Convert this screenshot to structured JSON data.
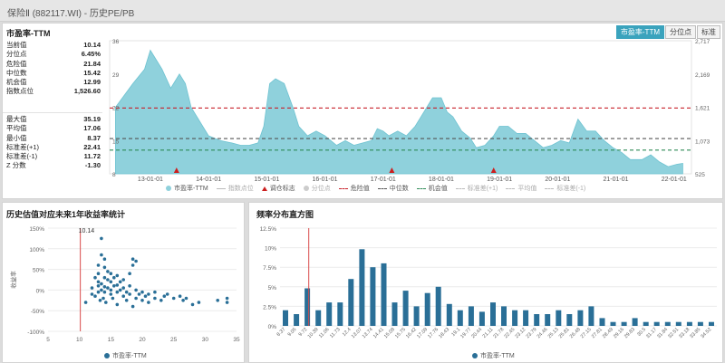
{
  "window": {
    "title": "保险Ⅱ (882117.WI) - 历史PE/PB"
  },
  "top_panel": {
    "title": "市盈率-TTM",
    "tabs": [
      "市盈率-TTM",
      "分位点",
      "标准"
    ],
    "stats_group1": [
      {
        "label": "当前值",
        "value": "10.14"
      },
      {
        "label": "分位点",
        "value": "6.45%"
      },
      {
        "label": "危险值",
        "value": "21.84"
      },
      {
        "label": "中位数",
        "value": "15.42"
      },
      {
        "label": "机会值",
        "value": "12.99"
      },
      {
        "label": "指数点位",
        "value": "1,526.60"
      }
    ],
    "stats_group2": [
      {
        "label": "最大值",
        "value": "35.19"
      },
      {
        "label": "平均值",
        "value": "17.06"
      },
      {
        "label": "最小值",
        "value": "8.37"
      },
      {
        "label": "标准差(+1)",
        "value": "22.41"
      },
      {
        "label": "标准差(-1)",
        "value": "11.72"
      },
      {
        "label": "Z 分数",
        "value": "-1.30"
      }
    ],
    "legend": [
      {
        "label": "市盈率-TTM",
        "kind": "dot",
        "color": "#8fd1dc",
        "dim": false
      },
      {
        "label": "指数点位",
        "kind": "line",
        "color": "#bbbbbb",
        "dim": true
      },
      {
        "label": "调仓标志",
        "kind": "tri",
        "color": "#cc1f1f",
        "dim": false
      },
      {
        "label": "分位点",
        "kind": "dot",
        "color": "#cccccc",
        "dim": true
      },
      {
        "label": "危险值",
        "kind": "dash",
        "color": "#c8202a",
        "dim": false
      },
      {
        "label": "中位数",
        "kind": "dash",
        "color": "#555555",
        "dim": false
      },
      {
        "label": "机会值",
        "kind": "dash",
        "color": "#2e8b57",
        "dim": false
      },
      {
        "label": "标准差(+1)",
        "kind": "dash",
        "color": "#bbbbbb",
        "dim": true
      },
      {
        "label": "平均值",
        "kind": "dash",
        "color": "#bbbbbb",
        "dim": true
      },
      {
        "label": "标准差(-1)",
        "kind": "dash",
        "color": "#bbbbbb",
        "dim": true
      }
    ]
  },
  "chart_data": [
    {
      "type": "area",
      "series": [
        {
          "name": "市盈率-TTM",
          "color": "#8fd1dc"
        }
      ],
      "x_tick_labels": [
        "13-01-01",
        "14-01-01",
        "15-01-01",
        "16-01-01",
        "17-01-01",
        "18-01-01",
        "19-01-01",
        "20-01-01",
        "21-01-01",
        "22-01-01"
      ],
      "x": [
        2012.4,
        2012.7,
        2012.9,
        2013.0,
        2013.2,
        2013.35,
        2013.5,
        2013.6,
        2013.7,
        2013.8,
        2013.9,
        2014.0,
        2014.2,
        2014.4,
        2014.55,
        2014.7,
        2014.85,
        2014.95,
        2015.05,
        2015.15,
        2015.3,
        2015.45,
        2015.55,
        2015.7,
        2015.85,
        2016.0,
        2016.2,
        2016.35,
        2016.5,
        2016.65,
        2016.8,
        2016.9,
        2017.0,
        2017.1,
        2017.25,
        2017.4,
        2017.55,
        2017.7,
        2017.85,
        2018.0,
        2018.1,
        2018.2,
        2018.35,
        2018.5,
        2018.6,
        2018.75,
        2018.9,
        2019.0,
        2019.15,
        2019.3,
        2019.45,
        2019.6,
        2019.75,
        2019.9,
        2020.05,
        2020.2,
        2020.35,
        2020.5,
        2020.65,
        2020.8,
        2020.95,
        2021.1,
        2021.25,
        2021.45,
        2021.6,
        2021.75,
        2021.9,
        2022.05,
        2022.15
      ],
      "y": [
        22,
        27,
        30,
        34,
        30,
        26,
        29,
        27,
        22,
        20,
        18,
        16,
        15,
        14.5,
        14,
        14,
        14.5,
        18,
        27,
        28,
        27,
        22,
        18,
        16,
        17,
        16,
        14,
        15,
        14,
        14.5,
        15,
        17.5,
        17,
        16,
        17,
        16,
        18,
        21,
        24,
        24,
        21,
        20,
        17,
        15.5,
        13.5,
        14,
        16,
        18,
        18,
        16.5,
        16.5,
        15,
        13.5,
        14,
        15,
        14.5,
        19.5,
        17,
        17,
        15,
        13.5,
        12.5,
        11,
        11,
        12,
        10.5,
        9.5,
        10,
        10.2
      ],
      "rebalance_markers_x": [
        2013.45,
        2017.15,
        2018.9
      ],
      "reference_lines": [
        {
          "name": "危险值",
          "value": 21.84,
          "color": "#c8202a"
        },
        {
          "name": "中位数",
          "value": 15.42,
          "color": "#555555"
        },
        {
          "name": "机会值",
          "value": 12.99,
          "color": "#2e8b57"
        }
      ],
      "xlim": [
        2012.3,
        2022.3
      ],
      "ylim": [
        8,
        36
      ],
      "y_left_ticks": [
        8,
        15,
        22,
        29,
        36
      ],
      "y_right_ticks": [
        525,
        "1,073",
        "1,621",
        "2,169",
        "2,717"
      ]
    },
    {
      "type": "scatter",
      "title": "历史估值对应未来1年收益率统计",
      "series": [
        {
          "name": "市盈率-TTM",
          "color": "#2a6f97"
        }
      ],
      "ylabel": "收益率",
      "current_value_line": 10.14,
      "current_value_label": "10.14",
      "x_ticks": [
        5,
        10,
        15,
        20,
        25,
        30,
        35
      ],
      "y_ticks": [
        "150%",
        "100%",
        "50%",
        "0%",
        "-50%",
        "-100%"
      ],
      "xlim": [
        5,
        35
      ],
      "ylim": [
        -100,
        150
      ],
      "points": [
        [
          11,
          -30
        ],
        [
          12,
          -10
        ],
        [
          12,
          5
        ],
        [
          12.5,
          -15
        ],
        [
          12.5,
          30
        ],
        [
          13,
          -5
        ],
        [
          13,
          10
        ],
        [
          13,
          20
        ],
        [
          13,
          40
        ],
        [
          13,
          60
        ],
        [
          13.3,
          -25
        ],
        [
          13.5,
          0
        ],
        [
          13.5,
          15
        ],
        [
          13.5,
          85
        ],
        [
          13.5,
          125
        ],
        [
          13.8,
          -20
        ],
        [
          14,
          -5
        ],
        [
          14,
          8
        ],
        [
          14,
          30
        ],
        [
          14,
          55
        ],
        [
          14,
          75
        ],
        [
          14.2,
          -30
        ],
        [
          14.5,
          5
        ],
        [
          14.5,
          25
        ],
        [
          14.5,
          45
        ],
        [
          15,
          -10
        ],
        [
          15,
          0
        ],
        [
          15,
          20
        ],
        [
          15,
          40
        ],
        [
          15.3,
          -20
        ],
        [
          15.5,
          10
        ],
        [
          15.5,
          30
        ],
        [
          16,
          -5
        ],
        [
          16,
          12
        ],
        [
          16,
          35
        ],
        [
          16,
          -35
        ],
        [
          16.5,
          0
        ],
        [
          16.5,
          20
        ],
        [
          17,
          -15
        ],
        [
          17,
          5
        ],
        [
          17,
          25
        ],
        [
          17.5,
          -25
        ],
        [
          17.5,
          -5
        ],
        [
          18,
          10
        ],
        [
          18,
          -10
        ],
        [
          18,
          40
        ],
        [
          18.5,
          -40
        ],
        [
          18.5,
          60
        ],
        [
          18.5,
          75
        ],
        [
          19,
          0
        ],
        [
          19,
          -20
        ],
        [
          19,
          70
        ],
        [
          19.5,
          -10
        ],
        [
          20,
          -5
        ],
        [
          20,
          -25
        ],
        [
          20.5,
          -15
        ],
        [
          21,
          -30
        ],
        [
          21,
          -10
        ],
        [
          22,
          -20
        ],
        [
          22,
          -5
        ],
        [
          23,
          -25
        ],
        [
          23.5,
          -15
        ],
        [
          24,
          -10
        ],
        [
          25,
          -20
        ],
        [
          26,
          -15
        ],
        [
          26.5,
          -25
        ],
        [
          27,
          -20
        ],
        [
          28,
          -35
        ],
        [
          29,
          -30
        ],
        [
          32,
          -25
        ],
        [
          33.5,
          -30
        ],
        [
          33.5,
          -20
        ]
      ]
    },
    {
      "type": "bar",
      "title": "频率分布直方图",
      "series": [
        {
          "name": "市盈率-TTM",
          "color": "#2a6f97"
        }
      ],
      "categories": [
        "8.37",
        "9.05",
        "9.72",
        "10.39",
        "11.06",
        "11.73",
        "12.4",
        "13.07",
        "13.74",
        "14.41",
        "15.08",
        "15.75",
        "16.42",
        "17.09",
        "17.76",
        "18.43",
        "19.1",
        "19.77",
        "20.44",
        "21.11",
        "21.78",
        "22.45",
        "23.12",
        "23.79",
        "24.46",
        "25.13",
        "25.8",
        "26.47",
        "27.14",
        "27.81",
        "28.48",
        "29.15",
        "29.82",
        "30.49",
        "31.16",
        "31.83",
        "32.5",
        "33.17",
        "33.84",
        "34.51"
      ],
      "x_tick_labels": [
        "8.37",
        "9.05",
        "9.72",
        "10.39",
        "11.06",
        "11.73",
        "12.4",
        "13.07",
        "13.74",
        "14.41",
        "15.08",
        "15.75",
        "16.42",
        "17.09",
        "17.76",
        "18.43",
        "19.1",
        "19.77",
        "20.44",
        "21.11",
        "21.78",
        "22.45",
        "23.12",
        "23.79",
        "24.46",
        "25.13",
        "25.81",
        "26.48",
        "27.15",
        "27.81",
        "28.49",
        "29.16",
        "29.83",
        "30.5",
        "31.17",
        "31.84",
        "32.51",
        "33.18",
        "33.85",
        "34.52"
      ],
      "values": [
        2,
        1.5,
        4.8,
        2,
        3,
        3,
        6,
        9.8,
        7.5,
        8,
        3,
        4.5,
        2.5,
        4.2,
        5,
        2.8,
        2,
        2.5,
        1.8,
        3,
        2.5,
        2,
        2,
        1.5,
        1.5,
        2,
        1.5,
        2,
        2.5,
        1,
        0.5,
        0.5,
        1,
        0.5,
        0.5,
        0.5,
        0.5,
        0.5,
        0.5,
        0.5
      ],
      "current_value_line": 10.14,
      "y_ticks": [
        "12.5%",
        "10%",
        "7.5%",
        "5%",
        "2.5%",
        "0%"
      ],
      "ylim": [
        0,
        12.5
      ]
    }
  ]
}
